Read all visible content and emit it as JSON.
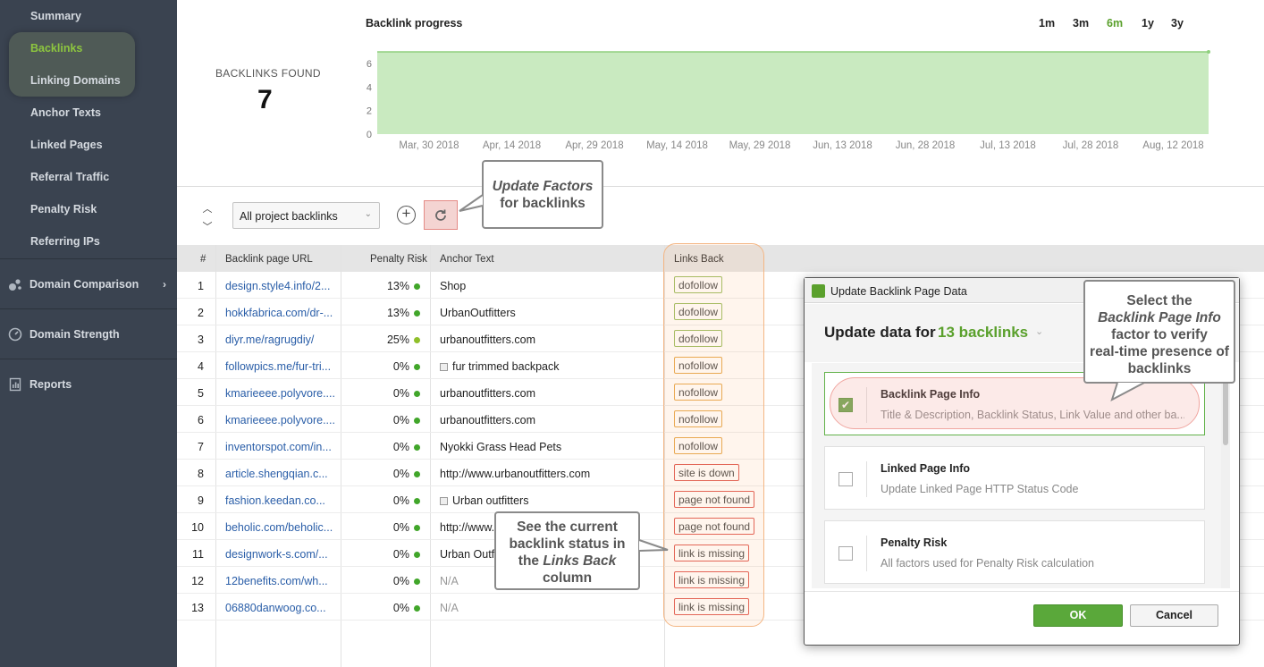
{
  "sidebar": {
    "items": [
      {
        "label": "Summary"
      },
      {
        "label": "Backlinks"
      },
      {
        "label": "Linking Domains"
      },
      {
        "label": "Anchor Texts"
      },
      {
        "label": "Linked Pages"
      },
      {
        "label": "Referral Traffic"
      },
      {
        "label": "Penalty Risk"
      },
      {
        "label": "Referring IPs"
      }
    ],
    "active_item": "Backlinks",
    "sections": [
      {
        "label": "Domain Comparison",
        "icon": "domain-comparison-icon",
        "chevron": "›"
      },
      {
        "label": "Domain Strength",
        "icon": "gauge-icon"
      },
      {
        "label": "Reports",
        "icon": "reports-icon"
      }
    ]
  },
  "summary": {
    "found_label": "BACKLINKS FOUND",
    "found_count": "7"
  },
  "chart_data": {
    "type": "area",
    "title": "Backlink progress",
    "x": [
      "Mar, 30 2018",
      "Apr, 14 2018",
      "Apr, 29 2018",
      "May, 14 2018",
      "May, 29 2018",
      "Jun, 13 2018",
      "Jun, 28 2018",
      "Jul, 13 2018",
      "Jul, 28 2018",
      "Aug, 12 2018"
    ],
    "series": [
      {
        "values": [
          7,
          7,
          7,
          7,
          7,
          7,
          7,
          7,
          7,
          7
        ]
      }
    ],
    "ylim": [
      0,
      7
    ],
    "yticks": [
      0,
      2,
      4,
      6
    ],
    "grid": false,
    "color": "#c9eac0",
    "line_color": "#8fd07e"
  },
  "ranges": [
    {
      "label": "1m",
      "active": false
    },
    {
      "label": "3m",
      "active": false
    },
    {
      "label": "6m",
      "active": true
    },
    {
      "label": "1y",
      "active": false
    },
    {
      "label": "3y",
      "active": false
    }
  ],
  "toolbar": {
    "filter_value": "All project backlinks",
    "sort_icon": "sort-updown-icon",
    "add_icon": "plus-circle-icon",
    "refresh_icon": "refresh-icon"
  },
  "callouts": {
    "update_factors": {
      "line1": "Update Factors",
      "line2": "for backlinks"
    },
    "links_back": {
      "line1": "See the current",
      "line2": "backlink status in",
      "line3_pre": "the ",
      "line3_em": "Links Back",
      "line4": "column"
    },
    "select": {
      "line1": "Select the",
      "line2": "Backlink Page Info",
      "line3": "factor to verify",
      "line4": "real-time presence of",
      "line5": "backlinks"
    }
  },
  "table": {
    "columns": [
      "#",
      "Backlink page URL",
      "Penalty Risk",
      "Anchor Text",
      "Links Back"
    ],
    "rows": [
      {
        "num": "1",
        "url": "design.style4.info/2...",
        "risk": "13%",
        "anchor": "Shop",
        "anchor_img": false,
        "status": "dofollow",
        "status_kind": "g"
      },
      {
        "num": "2",
        "url": "hokkfabrica.com/dr-...",
        "risk": "13%",
        "anchor": "UrbanOutfitters",
        "anchor_img": false,
        "status": "dofollow",
        "status_kind": "g"
      },
      {
        "num": "3",
        "url": "diyr.me/ragrugdiy/",
        "risk": "25%",
        "anchor": "urbanoutfitters.com",
        "anchor_img": false,
        "status": "dofollow",
        "status_kind": "g",
        "dot": "y"
      },
      {
        "num": "4",
        "url": "followpics.me/fur-tri...",
        "risk": "0%",
        "anchor": "fur trimmed backpack",
        "anchor_img": true,
        "status": "nofollow",
        "status_kind": "o"
      },
      {
        "num": "5",
        "url": "kmarieeee.polyvore....",
        "risk": "0%",
        "anchor": "urbanoutfitters.com",
        "anchor_img": false,
        "status": "nofollow",
        "status_kind": "o"
      },
      {
        "num": "6",
        "url": "kmarieeee.polyvore....",
        "risk": "0%",
        "anchor": "urbanoutfitters.com",
        "anchor_img": false,
        "status": "nofollow",
        "status_kind": "o"
      },
      {
        "num": "7",
        "url": "inventorspot.com/in...",
        "risk": "0%",
        "anchor": "Nyokki Grass Head Pets",
        "anchor_img": false,
        "status": "nofollow",
        "status_kind": "o"
      },
      {
        "num": "8",
        "url": "article.shengqian.c...",
        "risk": "0%",
        "anchor": "http://www.urbanoutfitters.com",
        "anchor_img": false,
        "status": "site is down",
        "status_kind": "r"
      },
      {
        "num": "9",
        "url": "fashion.keedan.co...",
        "risk": "0%",
        "anchor": "Urban outfitters",
        "anchor_img": true,
        "status": "page not found",
        "status_kind": "r"
      },
      {
        "num": "10",
        "url": "beholic.com/beholic...",
        "risk": "0%",
        "anchor": "http://www.u",
        "anchor_img": false,
        "status": "page not found",
        "status_kind": "r"
      },
      {
        "num": "11",
        "url": "designwork-s.com/...",
        "risk": "0%",
        "anchor": "Urban Outfi",
        "anchor_img": false,
        "status": "link is missing",
        "status_kind": "r"
      },
      {
        "num": "12",
        "url": "12benefits.com/wh...",
        "risk": "0%",
        "anchor": "N/A",
        "anchor_img": false,
        "status": "link is missing",
        "status_kind": "r",
        "na": true
      },
      {
        "num": "13",
        "url": "06880danwoog.co...",
        "risk": "0%",
        "anchor": "N/A",
        "anchor_img": false,
        "status": "link is missing",
        "status_kind": "r",
        "na": true
      }
    ]
  },
  "dialog": {
    "title": "Update Backlink Page Data",
    "heading": "Update data for",
    "count": "13 backlinks",
    "options": [
      {
        "title": "Backlink Page Info",
        "desc": "Title & Description, Backlink Status, Link Value and other ba...",
        "checked": true
      },
      {
        "title": "Linked Page Info",
        "desc": "Update Linked Page HTTP Status Code",
        "checked": false
      },
      {
        "title": "Penalty Risk",
        "desc": "All factors used for Penalty Risk calculation",
        "checked": false
      }
    ],
    "ok_label": "OK",
    "cancel_label": "Cancel"
  }
}
